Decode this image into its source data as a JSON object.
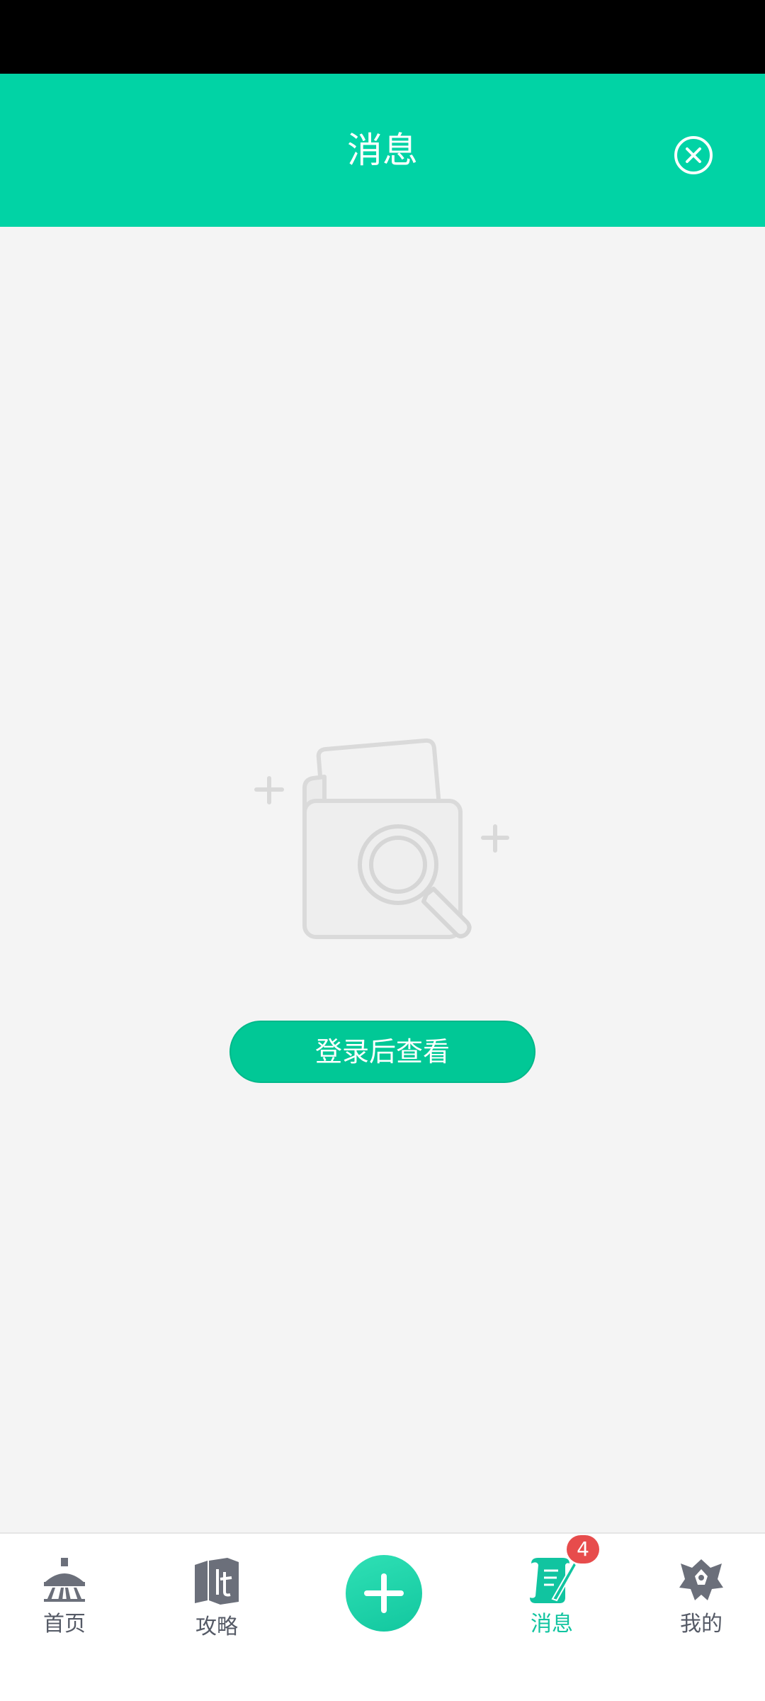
{
  "header": {
    "title": "消息",
    "close_icon": "close-circle-icon"
  },
  "empty_state": {
    "illustration_icon": "empty-folder-search-icon",
    "login_button_label": "登录后查看"
  },
  "tabbar": {
    "items": [
      {
        "label": "首页",
        "icon": "home-pavilion-icon",
        "active": false
      },
      {
        "label": "攻略",
        "icon": "guide-book-icon",
        "active": false
      },
      {
        "label": "",
        "icon": "add-icon",
        "active": false
      },
      {
        "label": "消息",
        "icon": "message-scroll-icon",
        "active": true,
        "badge": "4"
      },
      {
        "label": "我的",
        "icon": "profile-crest-icon",
        "active": false
      }
    ]
  },
  "colors": {
    "brand": "#01d3a5",
    "button": "#01c896",
    "tab_active": "#11c4a0",
    "tab_inactive": "#555a66",
    "badge": "#e74c4c",
    "background": "#f4f4f4"
  }
}
